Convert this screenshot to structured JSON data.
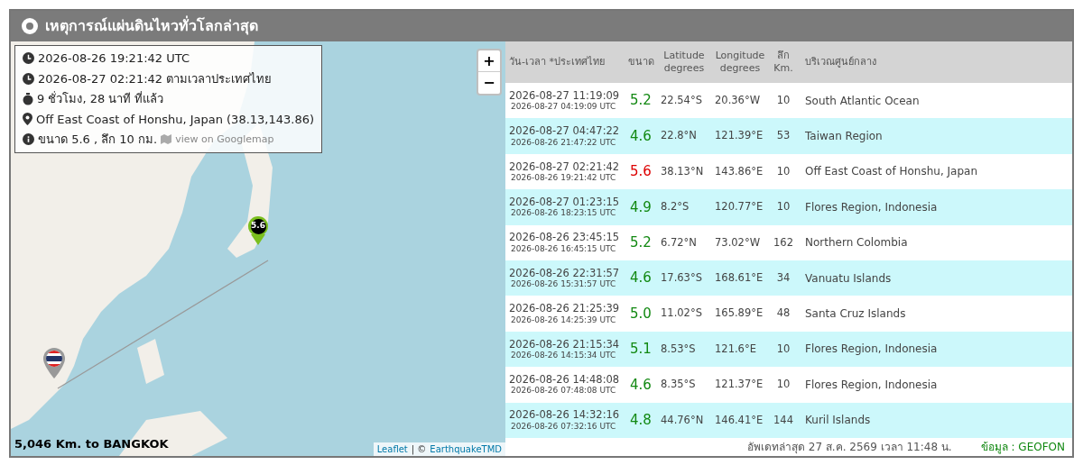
{
  "header": {
    "title": "เหตุการณ์แผ่นดินไหวทั่วโลกล่าสุด"
  },
  "map": {
    "info": {
      "utc": "2026-08-26 19:21:42 UTC",
      "local": "2026-08-27 02:21:42 ตามเวลาประเทศไทย",
      "ago": "9 ชั่วโมง, 28 นาที ที่แล้ว",
      "place": "Off East Coast of Honshu, Japan (38.13,143.86)",
      "summary": "ขนาด 5.6 , ลึก 10 กม.",
      "map_link": "view on Googlemap"
    },
    "zoom_in": "+",
    "zoom_out": "−",
    "marker": "5.6",
    "distance": "5,046 Km. to BANGKOK",
    "attribution_leaflet": "Leaflet",
    "attribution_sep": "| ©",
    "attribution_owner": "EarthquakeTMD"
  },
  "table": {
    "columns": [
      "วัน-เวลา *ประเทศไทย",
      "ขนาด",
      "Latitude degrees",
      "Longitude degrees",
      "ลึก Km.",
      "บริเวณศูนย์กลาง"
    ],
    "rows": [
      {
        "local": "2026-08-27 11:19:09",
        "utc": "2026-08-27 04:19:09 UTC",
        "mag": "5.2",
        "lat": "22.54°S",
        "lon": "20.36°W",
        "depth": "10",
        "region": "South Atlantic Ocean",
        "selected": false
      },
      {
        "local": "2026-08-27 04:47:22",
        "utc": "2026-08-26 21:47:22 UTC",
        "mag": "4.6",
        "lat": "22.8°N",
        "lon": "121.39°E",
        "depth": "53",
        "region": "Taiwan Region",
        "selected": false
      },
      {
        "local": "2026-08-27 02:21:42",
        "utc": "2026-08-26 19:21:42 UTC",
        "mag": "5.6",
        "lat": "38.13°N",
        "lon": "143.86°E",
        "depth": "10",
        "region": "Off East Coast of Honshu, Japan",
        "selected": true
      },
      {
        "local": "2026-08-27 01:23:15",
        "utc": "2026-08-26 18:23:15 UTC",
        "mag": "4.9",
        "lat": "8.2°S",
        "lon": "120.77°E",
        "depth": "10",
        "region": "Flores Region, Indonesia",
        "selected": false
      },
      {
        "local": "2026-08-26 23:45:15",
        "utc": "2026-08-26 16:45:15 UTC",
        "mag": "5.2",
        "lat": "6.72°N",
        "lon": "73.02°W",
        "depth": "162",
        "region": "Northern Colombia",
        "selected": false
      },
      {
        "local": "2026-08-26 22:31:57",
        "utc": "2026-08-26 15:31:57 UTC",
        "mag": "4.6",
        "lat": "17.63°S",
        "lon": "168.61°E",
        "depth": "34",
        "region": "Vanuatu Islands",
        "selected": false
      },
      {
        "local": "2026-08-26 21:25:39",
        "utc": "2026-08-26 14:25:39 UTC",
        "mag": "5.0",
        "lat": "11.02°S",
        "lon": "165.89°E",
        "depth": "48",
        "region": "Santa Cruz Islands",
        "selected": false
      },
      {
        "local": "2026-08-26 21:15:34",
        "utc": "2026-08-26 14:15:34 UTC",
        "mag": "5.1",
        "lat": "8.53°S",
        "lon": "121.6°E",
        "depth": "10",
        "region": "Flores Region, Indonesia",
        "selected": false
      },
      {
        "local": "2026-08-26 14:48:08",
        "utc": "2026-08-26 07:48:08 UTC",
        "mag": "4.6",
        "lat": "8.35°S",
        "lon": "121.37°E",
        "depth": "10",
        "region": "Flores Region, Indonesia",
        "selected": false
      },
      {
        "local": "2026-08-26 14:32:16",
        "utc": "2026-08-26 07:32:16 UTC",
        "mag": "4.8",
        "lat": "44.76°N",
        "lon": "146.41°E",
        "depth": "144",
        "region": "Kuril Islands",
        "selected": false
      }
    ],
    "updated": "อัพเดทล่าสุด 27 ส.ค. 2569 เวลา 11:48 น.",
    "source": "ข้อมูล : GEOFON"
  }
}
